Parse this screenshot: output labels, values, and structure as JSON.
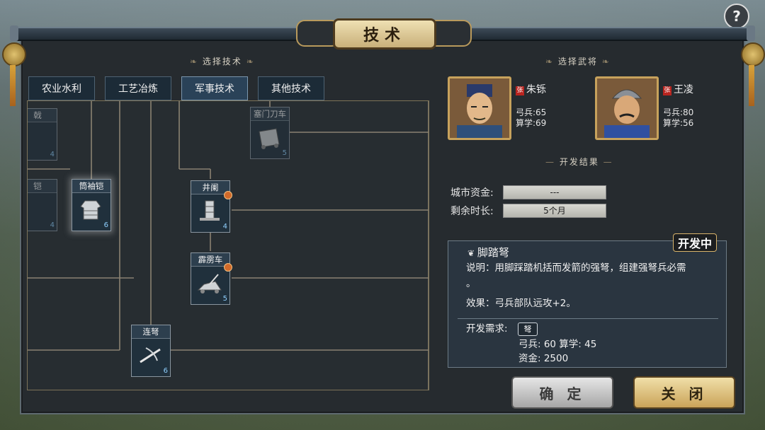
{
  "title": "技术",
  "help_label": "?",
  "left": {
    "section_title": "选择技术",
    "tabs": [
      {
        "label": "农业水利",
        "active": false
      },
      {
        "label": "工艺冶炼",
        "active": false
      },
      {
        "label": "军事技术",
        "active": true
      },
      {
        "label": "其他技术",
        "active": false
      }
    ],
    "nodes": [
      {
        "id": "n-partial-1",
        "label": "戟",
        "level": "4",
        "dim": true,
        "checked": false,
        "icon": "weapon-icon"
      },
      {
        "id": "n-partial-2",
        "label": "铠",
        "level": "4",
        "dim": true,
        "checked": false,
        "icon": "horse-icon"
      },
      {
        "id": "n-armor",
        "label": "筒袖铠",
        "level": "6",
        "dim": false,
        "checked": false,
        "selected": true,
        "icon": "armor-icon"
      },
      {
        "id": "n-saimen",
        "label": "塞门刀车",
        "level": "5",
        "dim": true,
        "checked": false,
        "icon": "blade-cart-icon"
      },
      {
        "id": "n-jinglan",
        "label": "井阑",
        "level": "4",
        "dim": false,
        "checked": true,
        "icon": "siege-tower-icon"
      },
      {
        "id": "n-pilice",
        "label": "霹雳车",
        "level": "5",
        "dim": false,
        "checked": true,
        "icon": "catapult-icon"
      },
      {
        "id": "n-liannu",
        "label": "连弩",
        "level": "6",
        "dim": false,
        "checked": false,
        "icon": "crossbow-icon"
      }
    ]
  },
  "right": {
    "generals_title": "选择武将",
    "generals": [
      {
        "name": "朱铄",
        "tag": "张",
        "stat1": "弓兵:65",
        "stat2": "算学:69"
      },
      {
        "name": "王凌",
        "tag": "张",
        "stat1": "弓兵:80",
        "stat2": "算学:56"
      }
    ],
    "result_title": "开发结果",
    "funds_label": "城市资金:",
    "funds_value": "---",
    "time_label": "剩余时长:",
    "time_value": "5个月",
    "status_badge": "开发中",
    "tech_name": "脚踏弩",
    "desc_line1": "说明：用脚踩踏机括而发箭的强弩，组建强弩兵必需",
    "desc_line2": "。",
    "effect": "效果：弓兵部队远攻+2。",
    "req_label": "开发需求:",
    "req_chip": "弩",
    "req_stats": "弓兵: 60 算学: 45",
    "req_funds": "资金: 2500"
  },
  "buttons": {
    "ok": "确 定",
    "close": "关 闭"
  }
}
